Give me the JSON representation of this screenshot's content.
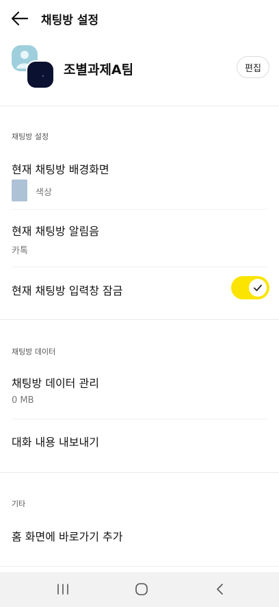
{
  "header": {
    "title": "채팅방 설정"
  },
  "profile": {
    "room_name": "조별과제A팀",
    "edit_label": "편집"
  },
  "sections": {
    "chatroom_settings": {
      "label": "채팅방 설정",
      "background": {
        "title": "현재 채팅방 배경화면",
        "value": "색상",
        "swatch_color": "#aec2d6"
      },
      "notification_sound": {
        "title": "현재 채팅방 알림음",
        "value": "카톡"
      },
      "input_lock": {
        "title": "현재 채팅방 입력창 잠금",
        "enabled": true
      }
    },
    "chatroom_data": {
      "label": "채팅방 데이터",
      "manage": {
        "title": "채팅방 데이터 관리",
        "value": "0 MB"
      },
      "export": {
        "title": "대화 내용 내보내기"
      }
    },
    "etc": {
      "label": "기타",
      "home_shortcut": {
        "title": "홈 화면에 바로가기 추가"
      }
    }
  },
  "colors": {
    "toggle_on": "#fbe400",
    "navbar_bg": "#f2f2f2"
  },
  "navbar": {
    "icons": [
      "recent-apps-icon",
      "home-icon",
      "back-icon"
    ]
  }
}
